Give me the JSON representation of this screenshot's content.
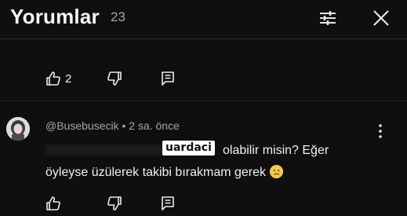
{
  "header": {
    "title": "Yorumlar",
    "count": "23"
  },
  "comment_above": {
    "like_count": "2"
  },
  "comment": {
    "author": "@Busebusecik",
    "time": "2 sa. önce",
    "overlay_username": "uardaci",
    "text_line1_visible": "olabilir misin? Eğer",
    "text_line2": "öyleyse üzülerek takibi bırakmam gerek",
    "emoji": "😢"
  },
  "icons": {
    "filter": "filter-sliders-icon",
    "close": "close-icon",
    "like": "thumb-up-icon",
    "dislike": "thumb-down-icon",
    "reply": "reply-comment-icon",
    "more": "more-vertical-icon"
  },
  "colors": {
    "background": "#0f0f0f",
    "text": "#f1f1f1",
    "secondary_text": "#a6a6a6"
  }
}
